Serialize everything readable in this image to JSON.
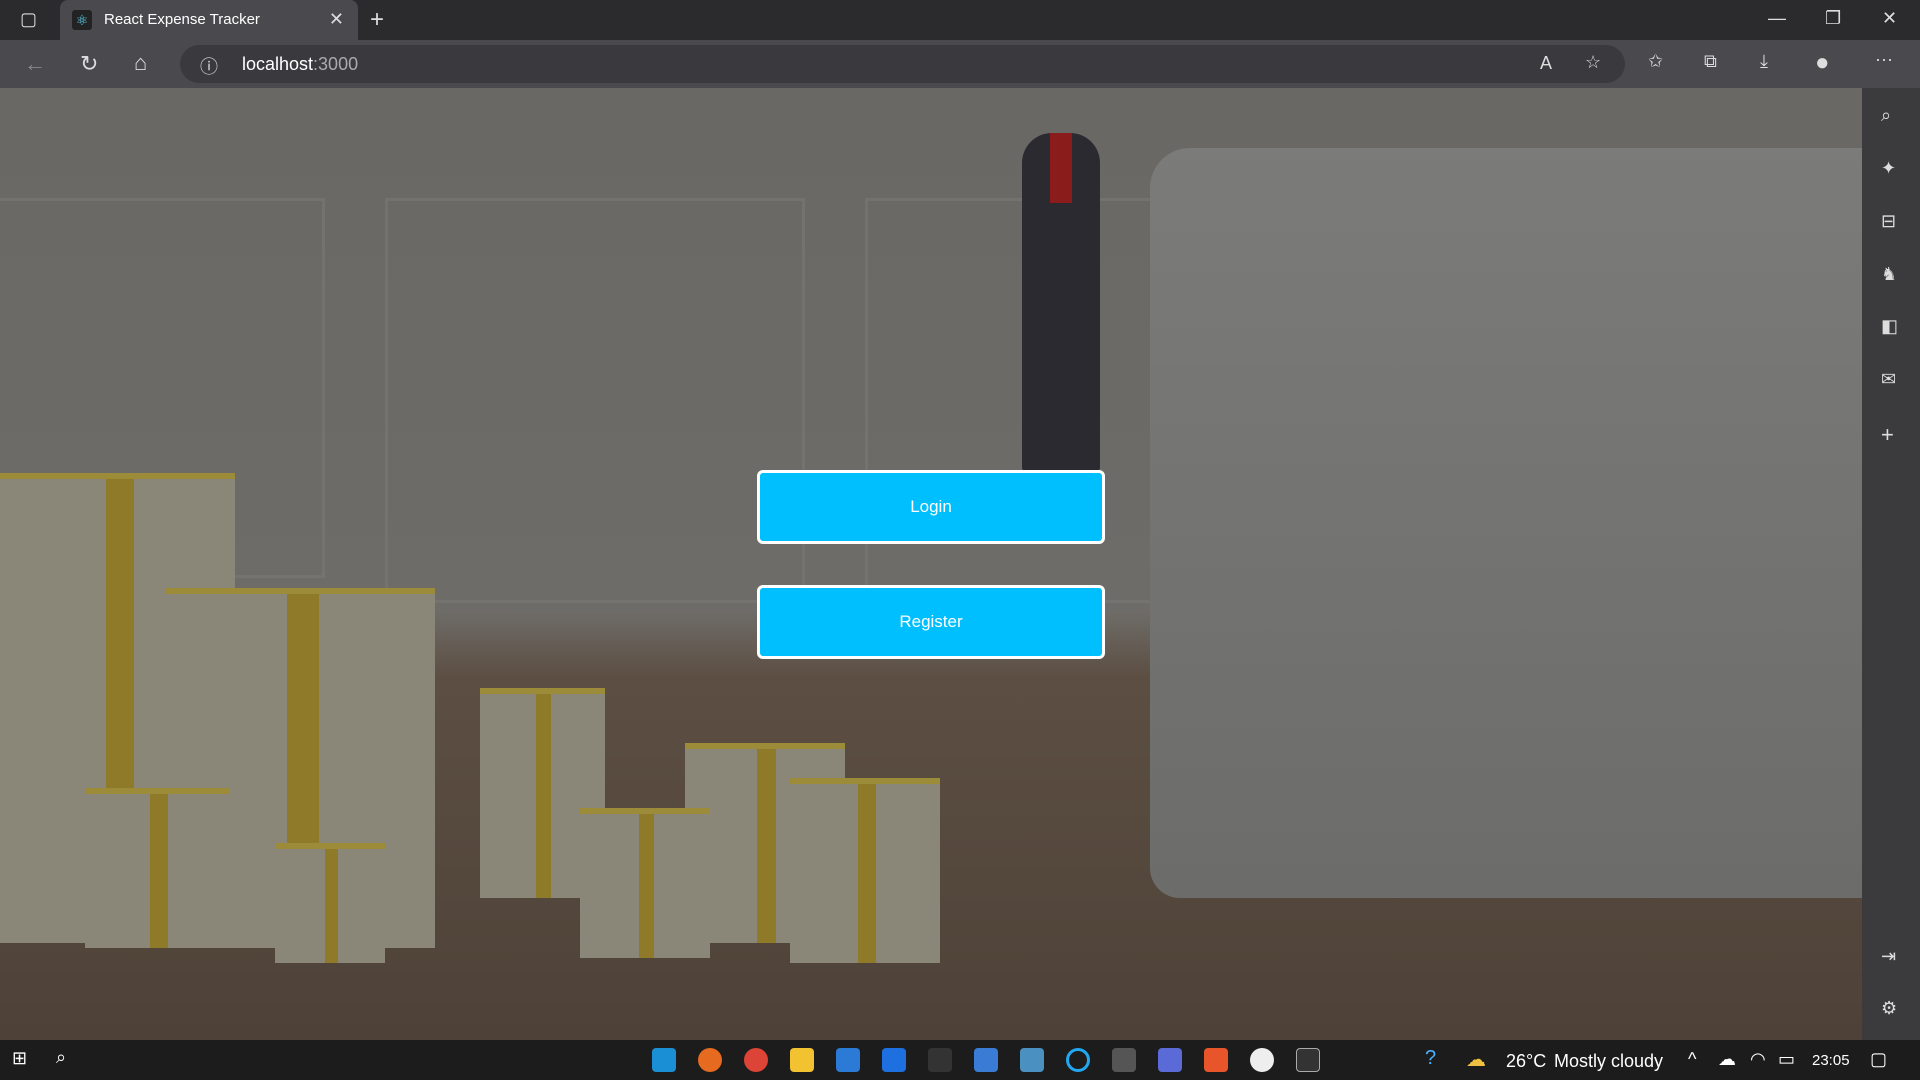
{
  "browser": {
    "tab_title": "React Expense Tracker",
    "url_host": "localhost",
    "url_port": ":3000"
  },
  "page": {
    "login_label": "Login",
    "register_label": "Register"
  },
  "taskbar": {
    "temperature": "26°C",
    "weather": "Mostly cloudy",
    "time": "23:05"
  },
  "colors": {
    "button": "#00bfff",
    "button_border": "#ffffff"
  }
}
